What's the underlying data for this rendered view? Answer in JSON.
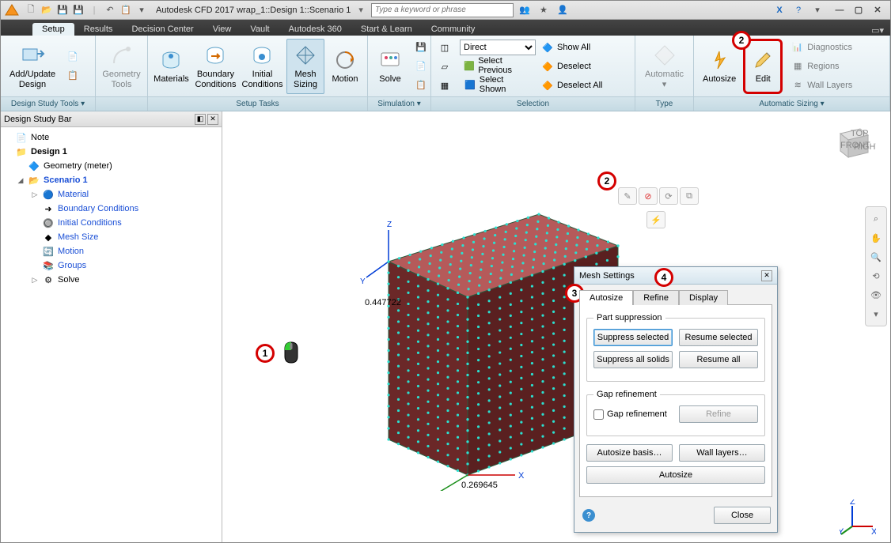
{
  "app": {
    "title": "Autodesk CFD 2017   wrap_1::Design 1::Scenario 1",
    "search_placeholder": "Type a keyword or phrase"
  },
  "tabs": [
    "Setup",
    "Results",
    "Decision Center",
    "View",
    "Vault",
    "Autodesk 360",
    "Start & Learn",
    "Community"
  ],
  "active_tab": "Setup",
  "ribbon": {
    "groups": {
      "dst": {
        "label": "Design Study Tools ▾",
        "btns": {
          "addupdate": "Add/Update\nDesign"
        }
      },
      "geom": {
        "label": "",
        "btns": {
          "gt": "Geometry\nTools"
        }
      },
      "setup": {
        "label": "Setup Tasks",
        "btns": {
          "mat": "Materials",
          "bc": "Boundary\nConditions",
          "ic": "Initial\nConditions",
          "mesh": "Mesh\nSizing",
          "motion": "Motion"
        }
      },
      "sim": {
        "label": "Simulation ▾",
        "btns": {
          "solve": "Solve"
        }
      },
      "sel": {
        "label": "Selection",
        "direct": "Direct",
        "showall": "Show All",
        "selprev": "Select Previous",
        "selsh": "Select Shown",
        "desel": "Deselect",
        "deselall": "Deselect All"
      },
      "type": {
        "label": "Type",
        "btns": {
          "auto": "Automatic ▾"
        }
      },
      "autos": {
        "label": "Automatic Sizing ▾",
        "btns": {
          "autosize": "Autosize",
          "edit": "Edit"
        },
        "side": {
          "diag": "Diagnostics",
          "reg": "Regions",
          "wl": "Wall Layers"
        }
      }
    }
  },
  "panel": {
    "title": "Design Study Bar"
  },
  "tree": {
    "note": "Note",
    "design": "Design 1",
    "geom": "Geometry (meter)",
    "scenario": "Scenario 1",
    "material": "Material",
    "bc": "Boundary Conditions",
    "ic": "Initial Conditions",
    "mesh": "Mesh Size",
    "motion": "Motion",
    "groups": "Groups",
    "solve": "Solve"
  },
  "viewport": {
    "coord_top": "0.447722",
    "coord_bottom": "0.269645",
    "axis_x": "X",
    "axis_y": "Y",
    "axis_z": "Z",
    "cube": {
      "top": "TOP",
      "front": "FRONT",
      "right": "RIGHT"
    }
  },
  "dialog": {
    "title": "Mesh Settings",
    "tabs": {
      "autosize": "Autosize",
      "refine": "Refine",
      "display": "Display"
    },
    "part_supp": "Part suppression",
    "suppress_sel": "Suppress selected",
    "resume_sel": "Resume selected",
    "suppress_all": "Suppress all solids",
    "resume_all": "Resume all",
    "gap_ref": "Gap refinement",
    "gap_chk": "Gap refinement",
    "refine_btn": "Refine",
    "autosize_basis": "Autosize basis…",
    "wall_layers": "Wall layers…",
    "autosize_btn": "Autosize",
    "close": "Close"
  },
  "callouts": {
    "c1": "1",
    "c2a": "2",
    "c2b": "2",
    "c3": "3",
    "c4": "4"
  }
}
